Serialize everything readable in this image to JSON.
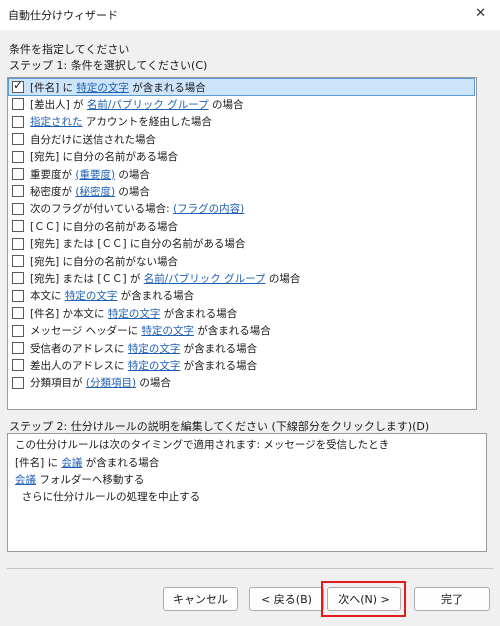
{
  "window": {
    "title": "自動仕分けウィザード",
    "close_glyph": "✕"
  },
  "instruction": "条件を指定してください",
  "step1": {
    "label": "ステップ 1: 条件を選択してください(C)"
  },
  "conditions": [
    {
      "checked": true,
      "parts": [
        {
          "t": "[件名] に "
        },
        {
          "t": "特定の文字",
          "link": true
        },
        {
          "t": " が含まれる場合"
        }
      ]
    },
    {
      "checked": false,
      "parts": [
        {
          "t": "[差出人] が "
        },
        {
          "t": "名前/パブリック グループ",
          "link": true
        },
        {
          "t": " の場合"
        }
      ]
    },
    {
      "checked": false,
      "parts": [
        {
          "t": "指定された",
          "link": true
        },
        {
          "t": " アカウントを経由した場合"
        }
      ]
    },
    {
      "checked": false,
      "parts": [
        {
          "t": "自分だけに送信された場合"
        }
      ]
    },
    {
      "checked": false,
      "parts": [
        {
          "t": "[宛先] に自分の名前がある場合"
        }
      ]
    },
    {
      "checked": false,
      "parts": [
        {
          "t": "重要度が "
        },
        {
          "t": "(重要度)",
          "link": true
        },
        {
          "t": " の場合"
        }
      ]
    },
    {
      "checked": false,
      "parts": [
        {
          "t": "秘密度が "
        },
        {
          "t": "(秘密度)",
          "link": true
        },
        {
          "t": " の場合"
        }
      ]
    },
    {
      "checked": false,
      "parts": [
        {
          "t": "次のフラグが付いている場合: "
        },
        {
          "t": "(フラグの内容)",
          "link": true
        }
      ]
    },
    {
      "checked": false,
      "parts": [
        {
          "t": "[ＣＣ] に自分の名前がある場合"
        }
      ]
    },
    {
      "checked": false,
      "parts": [
        {
          "t": "[宛先] または [ＣＣ] に自分の名前がある場合"
        }
      ]
    },
    {
      "checked": false,
      "parts": [
        {
          "t": "[宛先] に自分の名前がない場合"
        }
      ]
    },
    {
      "checked": false,
      "parts": [
        {
          "t": "[宛先] または [ＣＣ] が "
        },
        {
          "t": "名前/パブリック グループ",
          "link": true
        },
        {
          "t": " の場合"
        }
      ]
    },
    {
      "checked": false,
      "parts": [
        {
          "t": "本文に "
        },
        {
          "t": "特定の文字",
          "link": true
        },
        {
          "t": " が含まれる場合"
        }
      ]
    },
    {
      "checked": false,
      "parts": [
        {
          "t": "[件名] か本文に "
        },
        {
          "t": "特定の文字",
          "link": true
        },
        {
          "t": " が含まれる場合"
        }
      ]
    },
    {
      "checked": false,
      "parts": [
        {
          "t": "メッセージ ヘッダーに "
        },
        {
          "t": "特定の文字",
          "link": true
        },
        {
          "t": " が含まれる場合"
        }
      ]
    },
    {
      "checked": false,
      "parts": [
        {
          "t": "受信者のアドレスに "
        },
        {
          "t": "特定の文字",
          "link": true
        },
        {
          "t": " が含まれる場合"
        }
      ]
    },
    {
      "checked": false,
      "parts": [
        {
          "t": "差出人のアドレスに "
        },
        {
          "t": "特定の文字",
          "link": true
        },
        {
          "t": " が含まれる場合"
        }
      ]
    },
    {
      "checked": false,
      "parts": [
        {
          "t": "分類項目が "
        },
        {
          "t": "(分類項目)",
          "link": true
        },
        {
          "t": " の場合"
        }
      ]
    }
  ],
  "step2": {
    "label": "ステップ 2: 仕分けルールの説明を編集してください (下線部分をクリックします)(D)"
  },
  "description": [
    {
      "parts": [
        {
          "t": "この仕分けルールは次のタイミングで適用されます: メッセージを受信したとき"
        }
      ]
    },
    {
      "parts": [
        {
          "t": "[件名] に "
        },
        {
          "t": "会議",
          "link": true
        },
        {
          "t": " が含まれる場合"
        }
      ]
    },
    {
      "parts": [
        {
          "t": "会議",
          "link": true
        },
        {
          "t": " フォルダーへ移動する"
        }
      ]
    },
    {
      "parts": [
        {
          "t": "  さらに仕分けルールの処理を中止する"
        }
      ]
    }
  ],
  "buttons": {
    "cancel": "キャンセル",
    "back": "< 戻る(B)",
    "next": "次へ(N) >",
    "finish": "完了"
  },
  "colors": {
    "highlight": "#e21b1b",
    "link": "#1f5fb4",
    "selection": "#cde4fb"
  }
}
